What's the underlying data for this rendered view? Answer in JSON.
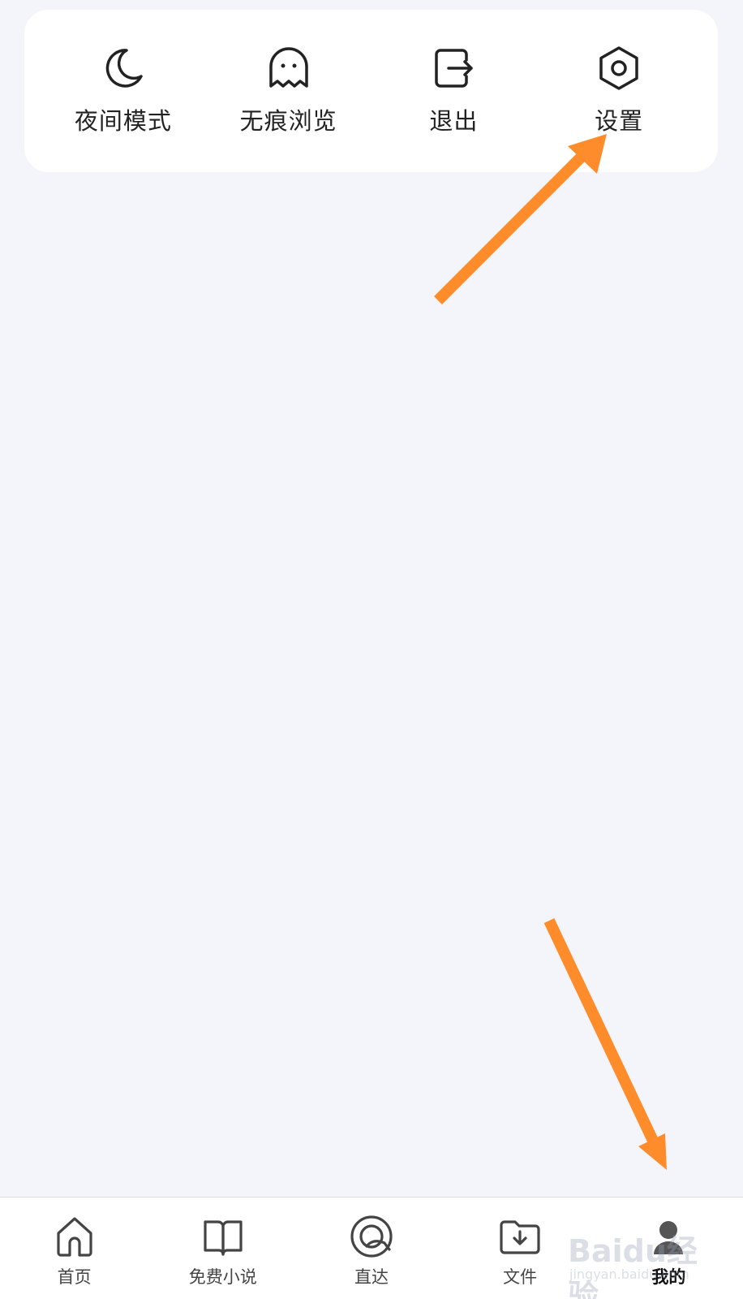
{
  "menu": {
    "items": [
      {
        "label": "夜间模式",
        "icon": "moon-icon"
      },
      {
        "label": "无痕浏览",
        "icon": "ghost-icon"
      },
      {
        "label": "退出",
        "icon": "exit-icon"
      },
      {
        "label": "设置",
        "icon": "settings-hexagon-icon"
      }
    ]
  },
  "tabbar": {
    "tabs": [
      {
        "label": "首页",
        "icon": "home-icon"
      },
      {
        "label": "免费小说",
        "icon": "book-icon"
      },
      {
        "label": "直达",
        "icon": "direct-icon"
      },
      {
        "label": "文件",
        "icon": "folder-download-icon"
      },
      {
        "label": "我的",
        "icon": "profile-icon",
        "active": true
      }
    ]
  },
  "colors": {
    "background": "#f4f5fa",
    "card": "#ffffff",
    "annotation_arrow": "#ff8c2a"
  },
  "watermark": {
    "brand": "Baidu经验",
    "sub": "jingyan.baidu.com"
  }
}
